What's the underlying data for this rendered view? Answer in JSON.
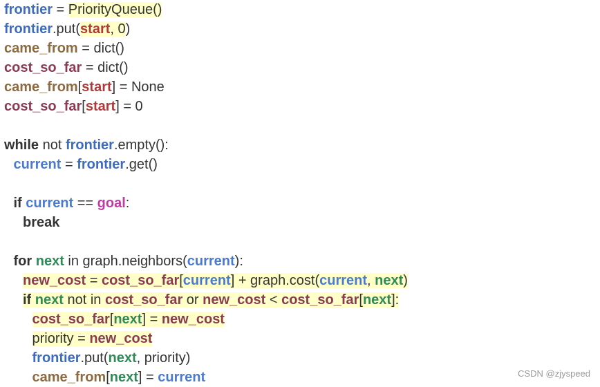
{
  "colors": {
    "plain": "#333333",
    "frontier": "#3d6bbf",
    "start": "#b03a3a",
    "came_from": "#8d6a3f",
    "cost_so_far": "#8a3a52",
    "current": "#4a7bd0",
    "goal": "#c13ba5",
    "next": "#2e8b57",
    "new_cost": "#8a3a52",
    "highlight": "#ffffc8"
  },
  "code_lines": [
    {
      "indent": 0,
      "tokens": [
        {
          "t": "frontier",
          "c": "frontier",
          "b": true
        },
        {
          "t": " = ",
          "c": "plain"
        },
        {
          "t": "PriorityQueue()",
          "c": "plain",
          "h": true
        }
      ]
    },
    {
      "indent": 0,
      "tokens": [
        {
          "t": "frontier",
          "c": "frontier",
          "b": true
        },
        {
          "t": ".put(",
          "c": "plain"
        },
        {
          "t": "start",
          "c": "start",
          "b": true,
          "h": true
        },
        {
          "t": ", ",
          "c": "plain",
          "h": true
        },
        {
          "t": "0",
          "c": "plain",
          "h": true
        },
        {
          "t": ")",
          "c": "plain"
        }
      ]
    },
    {
      "indent": 0,
      "tokens": [
        {
          "t": "came_from",
          "c": "came_from",
          "b": true
        },
        {
          "t": " = dict()",
          "c": "plain"
        }
      ]
    },
    {
      "indent": 0,
      "tokens": [
        {
          "t": "cost_so_far",
          "c": "cost_so_far",
          "b": true
        },
        {
          "t": " = dict()",
          "c": "plain"
        }
      ]
    },
    {
      "indent": 0,
      "tokens": [
        {
          "t": "came_from",
          "c": "came_from",
          "b": true
        },
        {
          "t": "[",
          "c": "plain"
        },
        {
          "t": "start",
          "c": "start",
          "b": true
        },
        {
          "t": "] = None",
          "c": "plain"
        }
      ]
    },
    {
      "indent": 0,
      "tokens": [
        {
          "t": "cost_so_far",
          "c": "cost_so_far",
          "b": true
        },
        {
          "t": "[",
          "c": "plain"
        },
        {
          "t": "start",
          "c": "start",
          "b": true
        },
        {
          "t": "] = 0",
          "c": "plain"
        }
      ]
    },
    {
      "indent": 0,
      "tokens": []
    },
    {
      "indent": 0,
      "tokens": [
        {
          "t": "while",
          "c": "plain",
          "b": true
        },
        {
          "t": " not ",
          "c": "plain"
        },
        {
          "t": "frontier",
          "c": "frontier",
          "b": true
        },
        {
          "t": ".empty():",
          "c": "plain"
        }
      ]
    },
    {
      "indent": 1,
      "tokens": [
        {
          "t": "current",
          "c": "current",
          "b": true
        },
        {
          "t": " = ",
          "c": "plain"
        },
        {
          "t": "frontier",
          "c": "frontier",
          "b": true
        },
        {
          "t": ".get()",
          "c": "plain"
        }
      ]
    },
    {
      "indent": 0,
      "tokens": []
    },
    {
      "indent": 1,
      "tokens": [
        {
          "t": "if",
          "c": "plain",
          "b": true
        },
        {
          "t": " ",
          "c": "plain"
        },
        {
          "t": "current",
          "c": "current",
          "b": true
        },
        {
          "t": " == ",
          "c": "plain"
        },
        {
          "t": "goal",
          "c": "goal",
          "b": true
        },
        {
          "t": ":",
          "c": "plain"
        }
      ]
    },
    {
      "indent": 2,
      "tokens": [
        {
          "t": "break",
          "c": "plain",
          "b": true
        }
      ]
    },
    {
      "indent": 0,
      "tokens": []
    },
    {
      "indent": 1,
      "tokens": [
        {
          "t": "for",
          "c": "plain",
          "b": true
        },
        {
          "t": " ",
          "c": "plain"
        },
        {
          "t": "next",
          "c": "next",
          "b": true
        },
        {
          "t": " in graph.neighbors(",
          "c": "plain"
        },
        {
          "t": "current",
          "c": "current",
          "b": true
        },
        {
          "t": "):",
          "c": "plain"
        }
      ]
    },
    {
      "indent": 2,
      "tokens": [
        {
          "t": "new_cost",
          "c": "new_cost",
          "b": true,
          "h": true
        },
        {
          "t": " = ",
          "c": "plain",
          "h": true
        },
        {
          "t": "cost_so_far",
          "c": "cost_so_far",
          "b": true,
          "h": true
        },
        {
          "t": "[",
          "c": "plain",
          "h": true
        },
        {
          "t": "current",
          "c": "current",
          "b": true,
          "h": true
        },
        {
          "t": "] + graph.cost(",
          "c": "plain",
          "h": true
        },
        {
          "t": "current",
          "c": "current",
          "b": true,
          "h": true
        },
        {
          "t": ", ",
          "c": "plain",
          "h": true
        },
        {
          "t": "next",
          "c": "next",
          "b": true,
          "h": true
        },
        {
          "t": ")",
          "c": "plain",
          "h": true
        }
      ]
    },
    {
      "indent": 2,
      "tokens": [
        {
          "t": "if",
          "c": "plain",
          "b": true,
          "h": true
        },
        {
          "t": " ",
          "c": "plain",
          "h": true
        },
        {
          "t": "next",
          "c": "next",
          "b": true,
          "h": true
        },
        {
          "t": " not in ",
          "c": "plain",
          "h": true
        },
        {
          "t": "cost_so_far",
          "c": "cost_so_far",
          "b": true,
          "h": true
        },
        {
          "t": " or ",
          "c": "plain",
          "h": true
        },
        {
          "t": "new_cost",
          "c": "new_cost",
          "b": true,
          "h": true
        },
        {
          "t": " < ",
          "c": "plain",
          "h": true
        },
        {
          "t": "cost_so_far",
          "c": "cost_so_far",
          "b": true,
          "h": true
        },
        {
          "t": "[",
          "c": "plain",
          "h": true
        },
        {
          "t": "next",
          "c": "next",
          "b": true,
          "h": true
        },
        {
          "t": "]:",
          "c": "plain",
          "h": true
        }
      ]
    },
    {
      "indent": 3,
      "tokens": [
        {
          "t": "cost_so_far",
          "c": "cost_so_far",
          "b": true,
          "h": true
        },
        {
          "t": "[",
          "c": "plain",
          "h": true
        },
        {
          "t": "next",
          "c": "next",
          "b": true,
          "h": true
        },
        {
          "t": "] = ",
          "c": "plain",
          "h": true
        },
        {
          "t": "new_cost",
          "c": "new_cost",
          "b": true,
          "h": true
        }
      ]
    },
    {
      "indent": 3,
      "tokens": [
        {
          "t": "priority",
          "c": "plain",
          "h": true
        },
        {
          "t": " = ",
          "c": "plain",
          "h": true
        },
        {
          "t": "new_cost",
          "c": "new_cost",
          "b": true,
          "h": true
        }
      ]
    },
    {
      "indent": 3,
      "tokens": [
        {
          "t": "frontier",
          "c": "frontier",
          "b": true
        },
        {
          "t": ".put(",
          "c": "plain"
        },
        {
          "t": "next",
          "c": "next",
          "b": true
        },
        {
          "t": ", priority)",
          "c": "plain"
        }
      ]
    },
    {
      "indent": 3,
      "tokens": [
        {
          "t": "came_from",
          "c": "came_from",
          "b": true
        },
        {
          "t": "[",
          "c": "plain"
        },
        {
          "t": "next",
          "c": "next",
          "b": true
        },
        {
          "t": "] = ",
          "c": "plain"
        },
        {
          "t": "current",
          "c": "current",
          "b": true
        }
      ]
    }
  ],
  "watermark": "CSDN @zjyspeed"
}
